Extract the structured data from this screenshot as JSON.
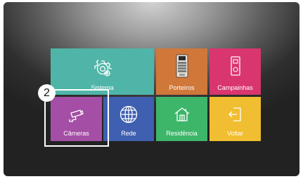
{
  "menu": {
    "tiles": [
      {
        "id": "sistema",
        "label": "Sistema",
        "icon": "gear-icon",
        "color": "#4fb5a8"
      },
      {
        "id": "porteiros",
        "label": "Porteiros",
        "icon": "door-panel-icon",
        "color": "#d0773a"
      },
      {
        "id": "campainhas",
        "label": "Campainhas",
        "icon": "doorbell-icon",
        "color": "#d9356f"
      },
      {
        "id": "cameras",
        "label": "Câmeras",
        "icon": "camera-icon",
        "color": "#a44fa5"
      },
      {
        "id": "rede",
        "label": "Rede",
        "icon": "globe-icon",
        "color": "#3f5fb0"
      },
      {
        "id": "residencia",
        "label": "Residência",
        "icon": "house-icon",
        "color": "#3db66a"
      },
      {
        "id": "voltar",
        "label": "Voltar",
        "icon": "exit-icon",
        "color": "#f0be30"
      }
    ]
  },
  "annotation": {
    "step_number": "2"
  }
}
